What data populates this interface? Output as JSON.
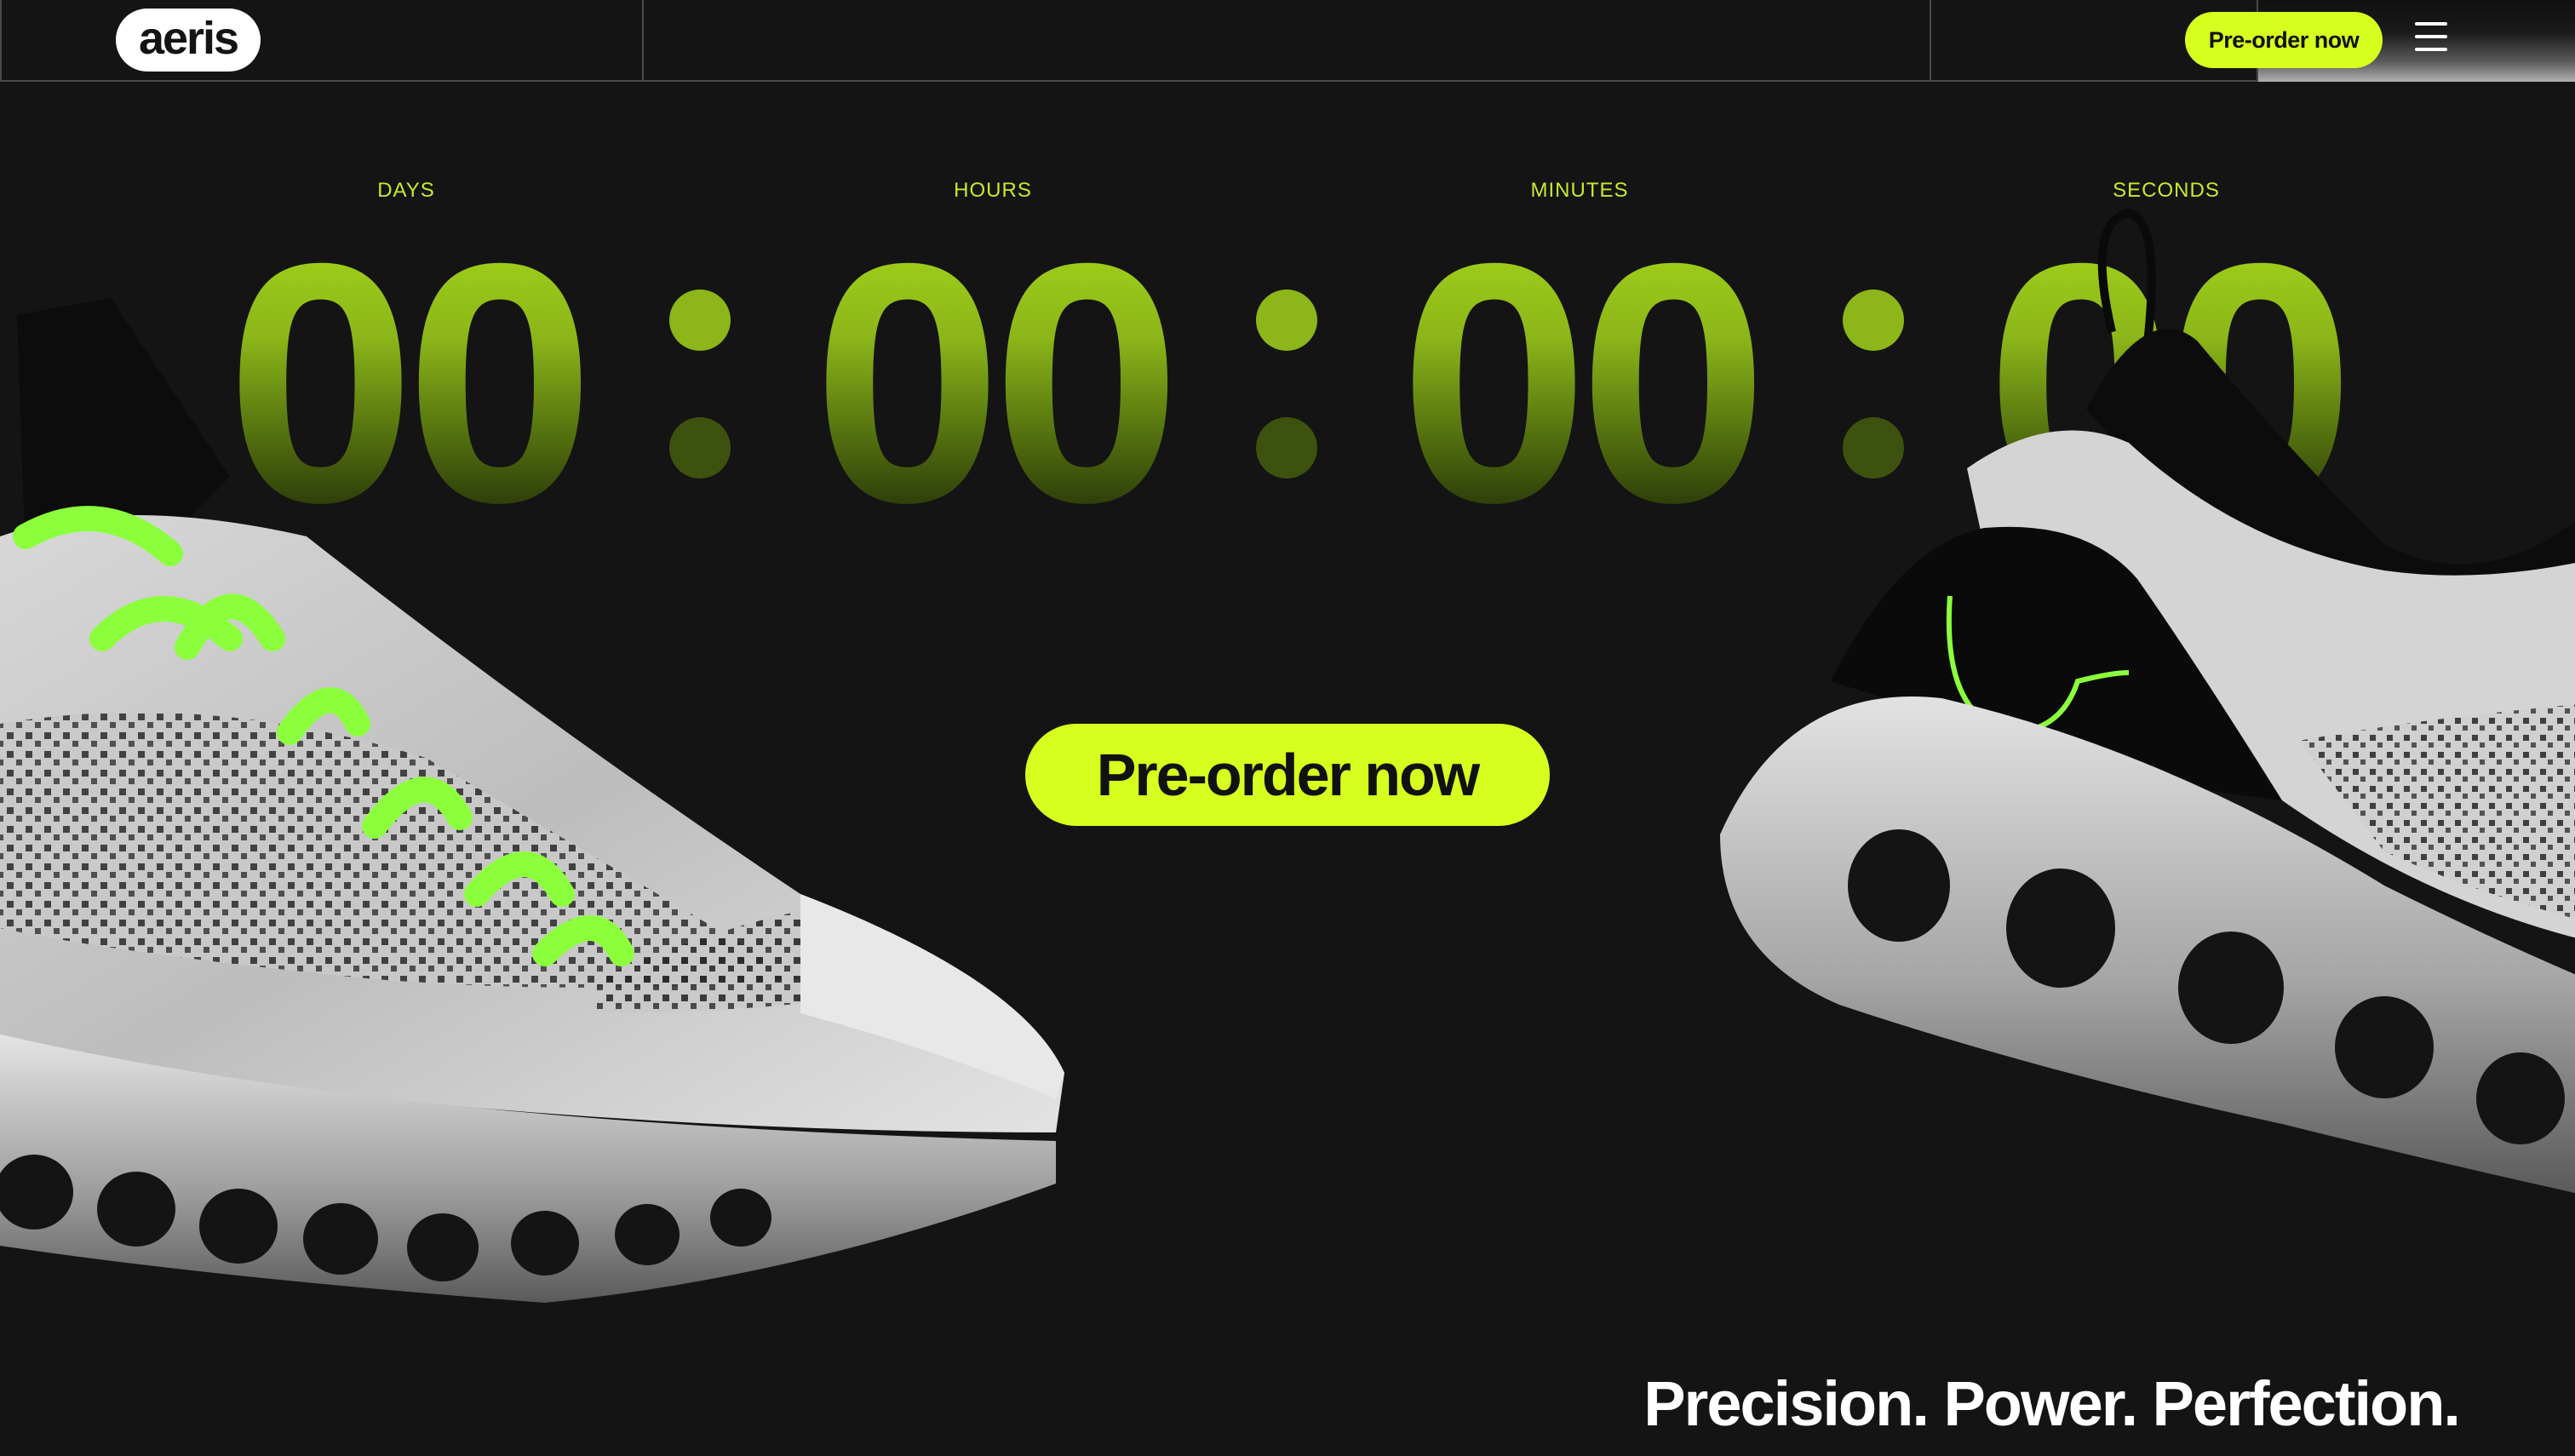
{
  "header": {
    "logo_text": "aeris",
    "cta_label": "Pre-order now",
    "menu_icon": "hamburger-menu-icon"
  },
  "countdown": {
    "units": [
      {
        "label": "DAYS",
        "value": "00"
      },
      {
        "label": "HOURS",
        "value": "00"
      },
      {
        "label": "MINUTES",
        "value": "00"
      },
      {
        "label": "SECONDS",
        "value": "00"
      }
    ]
  },
  "hero": {
    "cta_label": "Pre-order now",
    "tagline": "Precision. Power. Perfection."
  },
  "colors": {
    "accent": "#d6ff1f",
    "background": "#141414",
    "digit": "#a3d41a",
    "label": "#c9e830"
  }
}
